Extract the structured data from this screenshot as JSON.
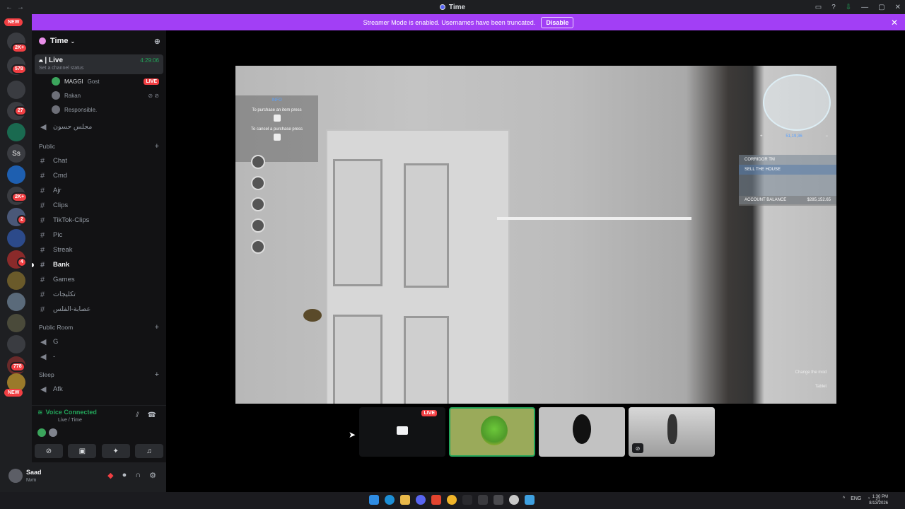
{
  "window": {
    "title": "Time"
  },
  "banner": {
    "text": "Streamer Mode is enabled. Usernames have been truncated.",
    "button": "Disable"
  },
  "rail": {
    "new_top": "NEW",
    "badges": [
      "2K+",
      "578",
      "27",
      "2K+",
      "2",
      "4",
      "778"
    ],
    "text_server": "Ss",
    "new_bottom": "NEW"
  },
  "server": {
    "name": "Time"
  },
  "live_channel": {
    "name": "ﻌ | Live",
    "status": "Set a channel status",
    "timer": "4:29:06"
  },
  "voice_users": [
    {
      "name": "MAGGI",
      "extra": "Gost",
      "tag": "LIVE"
    },
    {
      "name": "Rakan"
    },
    {
      "name": "Responsible."
    }
  ],
  "channels_top": [
    {
      "name": "مجلس حسون"
    }
  ],
  "categories": {
    "public": "Public",
    "public_room": "Public Room",
    "sleep": "Sleep"
  },
  "public_channels": [
    "Chat",
    "Cmd",
    "Ajr",
    "Clips",
    "TikTok-Clips",
    "Pic",
    "Streak",
    "Bank",
    "Games",
    "تكليجات",
    "عصابة-الفلس"
  ],
  "public_room_channels": [
    "G",
    "-"
  ],
  "sleep_channels": [
    "Afk"
  ],
  "voice_panel": {
    "status": "Voice Connected",
    "sub": "Live / Time"
  },
  "user": {
    "name": "Saad",
    "status": "Nvm"
  },
  "hud": {
    "info_title": "INFO",
    "line1": "To purchase an item press",
    "line2": "To cancel a purchase press",
    "map_coords": "51,19,36",
    "menu_title": "CORRIDOR TM",
    "menu_item": "SELL THE HOUSE",
    "balance_label": "ACCOUNT BALANCE",
    "balance_value": "$285,152.65",
    "bottom1": "Change the mod",
    "bottom2": "Tablet"
  },
  "tiles": {
    "live_tag": "LIVE"
  },
  "taskbar": {
    "lang": "ENG",
    "time": "1:30 PM",
    "date": "8/13/2026"
  }
}
